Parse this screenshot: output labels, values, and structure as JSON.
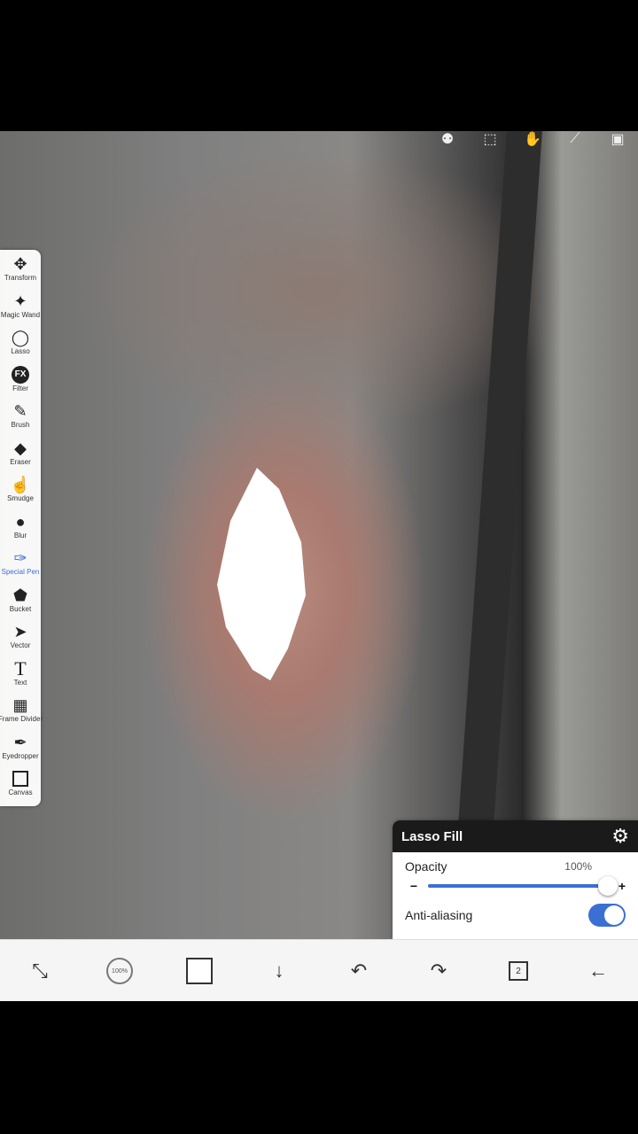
{
  "top_tools": [
    "layer-toggle-icon",
    "selection-icon",
    "hand-icon",
    "ruler-icon",
    "frame-icon"
  ],
  "left_toolbar": {
    "items": [
      {
        "label": "Transform",
        "icon": "✥"
      },
      {
        "label": "Magic Wand",
        "icon": "✦"
      },
      {
        "label": "Lasso",
        "icon": "◯"
      },
      {
        "label": "Filter",
        "icon": "FX"
      },
      {
        "label": "Brush",
        "icon": "✎"
      },
      {
        "label": "Eraser",
        "icon": "◆"
      },
      {
        "label": "Smudge",
        "icon": "☝"
      },
      {
        "label": "Blur",
        "icon": "💧"
      },
      {
        "label": "Special Pen",
        "icon": "✑"
      },
      {
        "label": "Bucket",
        "icon": "⬟"
      },
      {
        "label": "Vector",
        "icon": "➤"
      },
      {
        "label": "Text",
        "icon": "T"
      },
      {
        "label": "Frame Divider",
        "icon": "▦"
      },
      {
        "label": "Eyedropper",
        "icon": "✒"
      },
      {
        "label": "Canvas",
        "icon": "□"
      }
    ],
    "active": "Special Pen"
  },
  "lasso_panel": {
    "title": "Lasso Fill",
    "opacity_label": "Opacity",
    "opacity_value": "100%",
    "opacity_fraction": 1.0,
    "minus": "−",
    "plus": "+",
    "antialiasing_label": "Anti-aliasing",
    "antialiasing_on": true
  },
  "bottom_toolbar": {
    "brush_size_label": "100%",
    "layer_count": "2",
    "icons": [
      "modify-icon",
      "brush-size-icon",
      "color-swatch",
      "download-icon",
      "undo-icon",
      "redo-icon",
      "layers-icon",
      "back-icon"
    ]
  },
  "colors": {
    "accent": "#3b6fd4",
    "primary_color": "#ffffff"
  }
}
